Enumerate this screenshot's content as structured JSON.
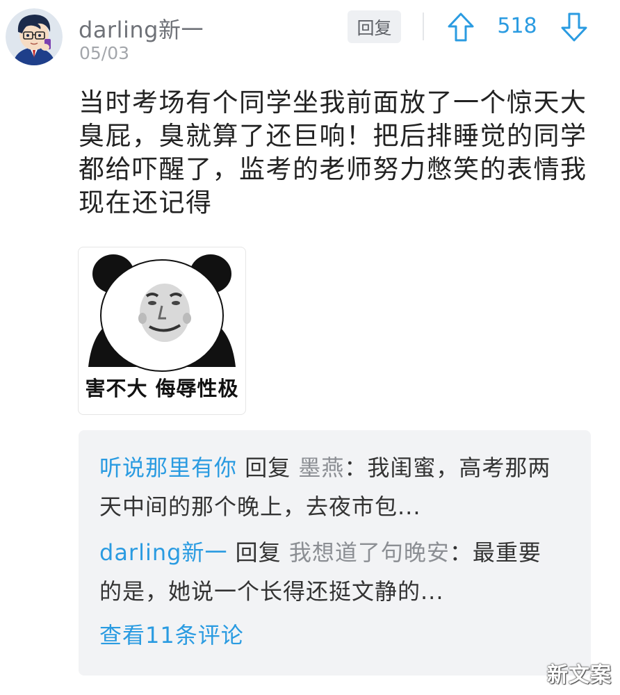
{
  "comment": {
    "username": "darling新一",
    "date": "05/03",
    "reply_label": "回复",
    "vote_count": "518",
    "body_lines": [
      "当时考场有个同学坐我前面放了一个惊天大",
      "臭屁，臭就算了还巨响！把后排睡觉的同学",
      "都给吓醒了，监考的老师努力憋笑的表情我",
      "现在还记得"
    ],
    "sticker_caption": "害不大 侮辱性极"
  },
  "subcomments": [
    {
      "user": "听说那里有你",
      "reply_word": "回复",
      "target": "墨燕",
      "sep": "：",
      "text": "我闺蜜，高考那两天中间的那个晚上，去夜市包..."
    },
    {
      "user": "darling新一",
      "reply_word": "回复",
      "target": "我想道了句晚安",
      "sep": "：",
      "text": "最重要的是，她说一个长得还挺文静的..."
    }
  ],
  "view_more": "查看11条评论",
  "watermark": "新文案",
  "colors": {
    "accent_blue": "#2a9be1",
    "username_gray": "#6f7278",
    "subbox_bg": "#f2f3f5"
  },
  "icons": {
    "upvote": "arrow-up-outline-icon",
    "downvote": "arrow-down-outline-icon"
  }
}
